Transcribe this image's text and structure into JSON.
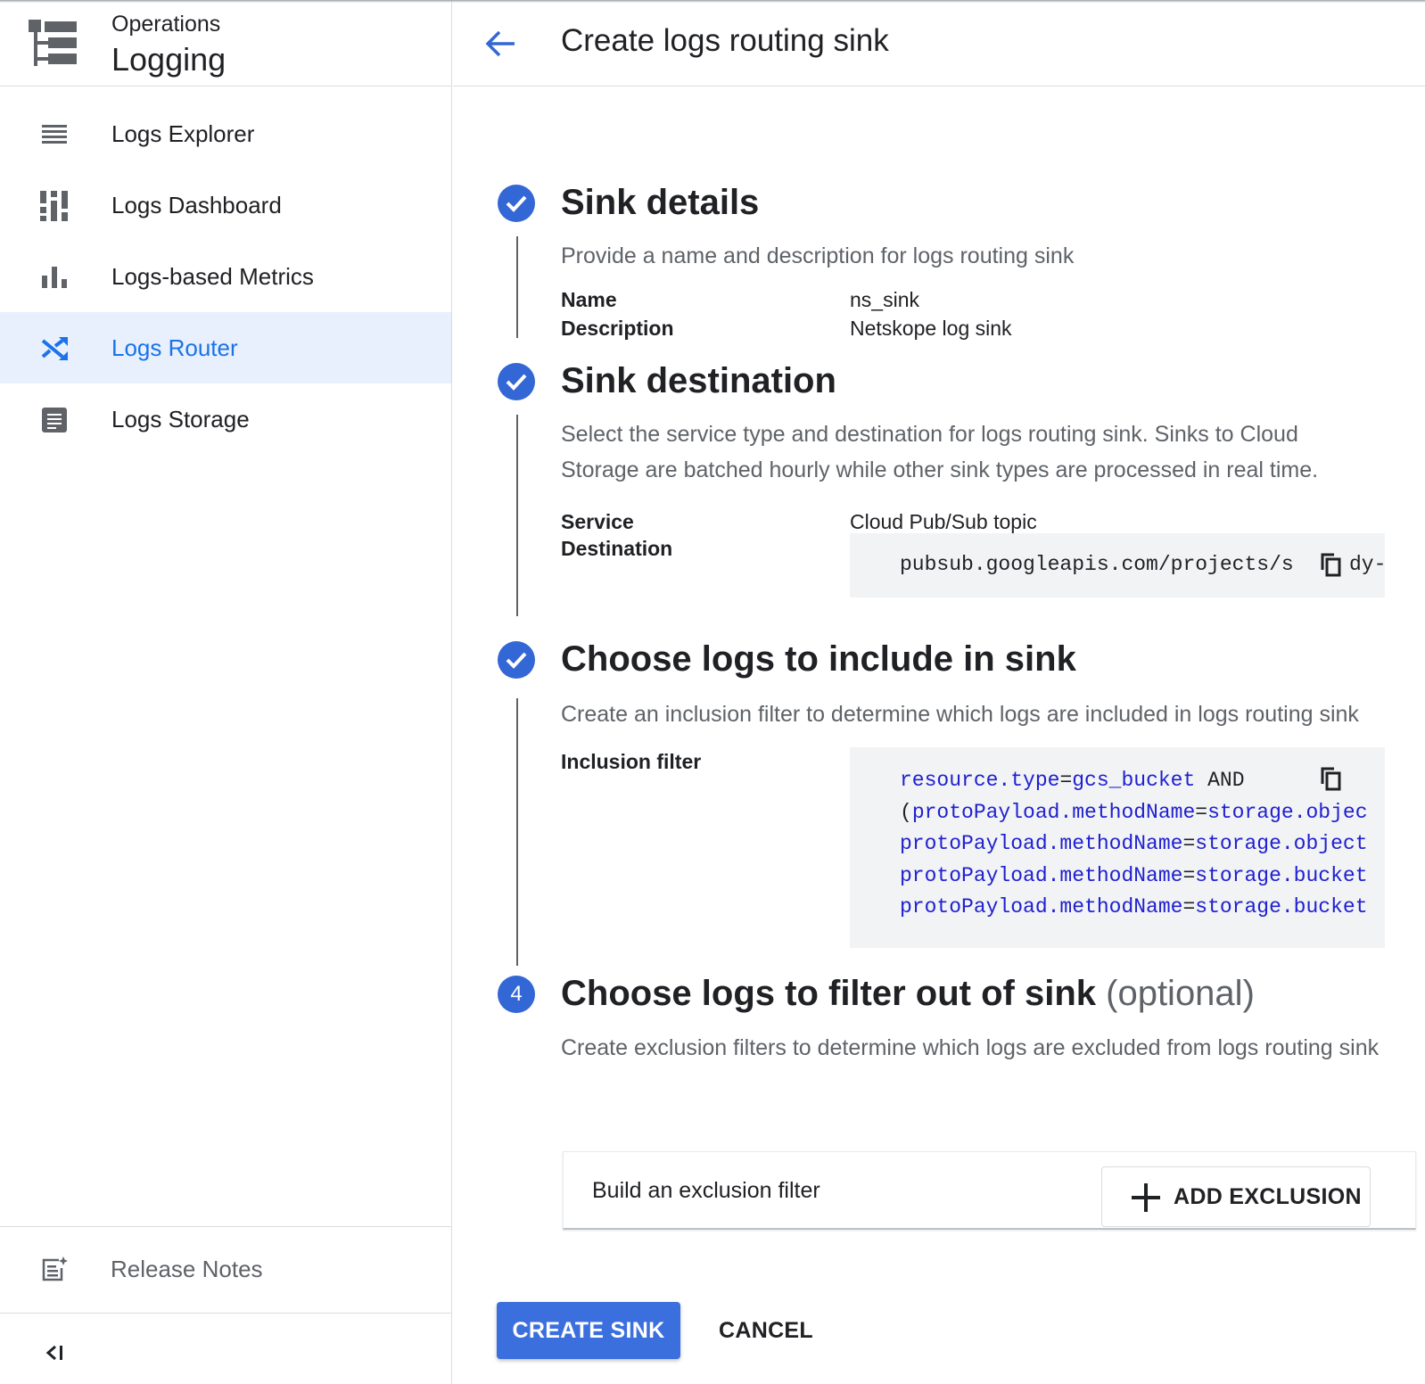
{
  "product": {
    "suptitle": "Operations",
    "name": "Logging"
  },
  "sidebar": {
    "items": [
      {
        "label": "Logs Explorer",
        "icon": "list-lines-icon",
        "active": false
      },
      {
        "label": "Logs Dashboard",
        "icon": "dashboard-icon",
        "active": false
      },
      {
        "label": "Logs-based Metrics",
        "icon": "bar-chart-icon",
        "active": false
      },
      {
        "label": "Logs Router",
        "icon": "shuffle-icon",
        "active": true
      },
      {
        "label": "Logs Storage",
        "icon": "storage-icon",
        "active": false
      }
    ],
    "release_notes": "Release Notes",
    "collapse_glyph": "<I"
  },
  "header": {
    "title": "Create logs routing sink"
  },
  "steps": {
    "details": {
      "title": "Sink details",
      "description": "Provide a name and description for logs routing sink",
      "name_key": "Name",
      "name_value": "ns_sink",
      "description_key": "Description",
      "description_value": "Netskope log sink"
    },
    "destination": {
      "title": "Sink destination",
      "description": "Select the service type and destination for logs routing sink. Sinks to Cloud Storage are batched hourly while other sink types are processed in real time.",
      "service_key": "Service",
      "service_value": "Cloud Pub/Sub topic",
      "destination_key": "Destination",
      "destination_value": "pubsub.googleapis.com/projects/s",
      "destination_tail": "dy-"
    },
    "include": {
      "title": "Choose logs to include in sink",
      "description": "Create an inclusion filter to determine which logs are included in logs routing sink",
      "filter_key": "Inclusion filter",
      "filter_lines": [
        {
          "prefix": "",
          "field": "resource.type",
          "eq": "=",
          "value": "gcs_bucket",
          "suffix": " AND"
        },
        {
          "prefix": "(",
          "field": "protoPayload.methodName",
          "eq": "=",
          "value": "storage.objec",
          "suffix": ""
        },
        {
          "prefix": "",
          "field": "protoPayload.methodName",
          "eq": "=",
          "value": "storage.object",
          "suffix": ""
        },
        {
          "prefix": "",
          "field": "protoPayload.methodName",
          "eq": "=",
          "value": "storage.bucket",
          "suffix": ""
        },
        {
          "prefix": "",
          "field": "protoPayload.methodName",
          "eq": "=",
          "value": "storage.bucket",
          "suffix": ""
        }
      ]
    },
    "exclude": {
      "number": "4",
      "title": "Choose logs to filter out of sink",
      "optional": "(optional)",
      "description": "Create exclusion filters to determine which logs are excluded from logs routing sink",
      "card_label": "Build an exclusion filter",
      "add_button": "ADD EXCLUSION"
    }
  },
  "actions": {
    "create": "CREATE SINK",
    "cancel": "CANCEL"
  },
  "colors": {
    "accent": "#1a73e8",
    "primary_button": "#3c6fde",
    "step_check": "#3367d6",
    "active_nav_bg": "#e8f0fe"
  }
}
